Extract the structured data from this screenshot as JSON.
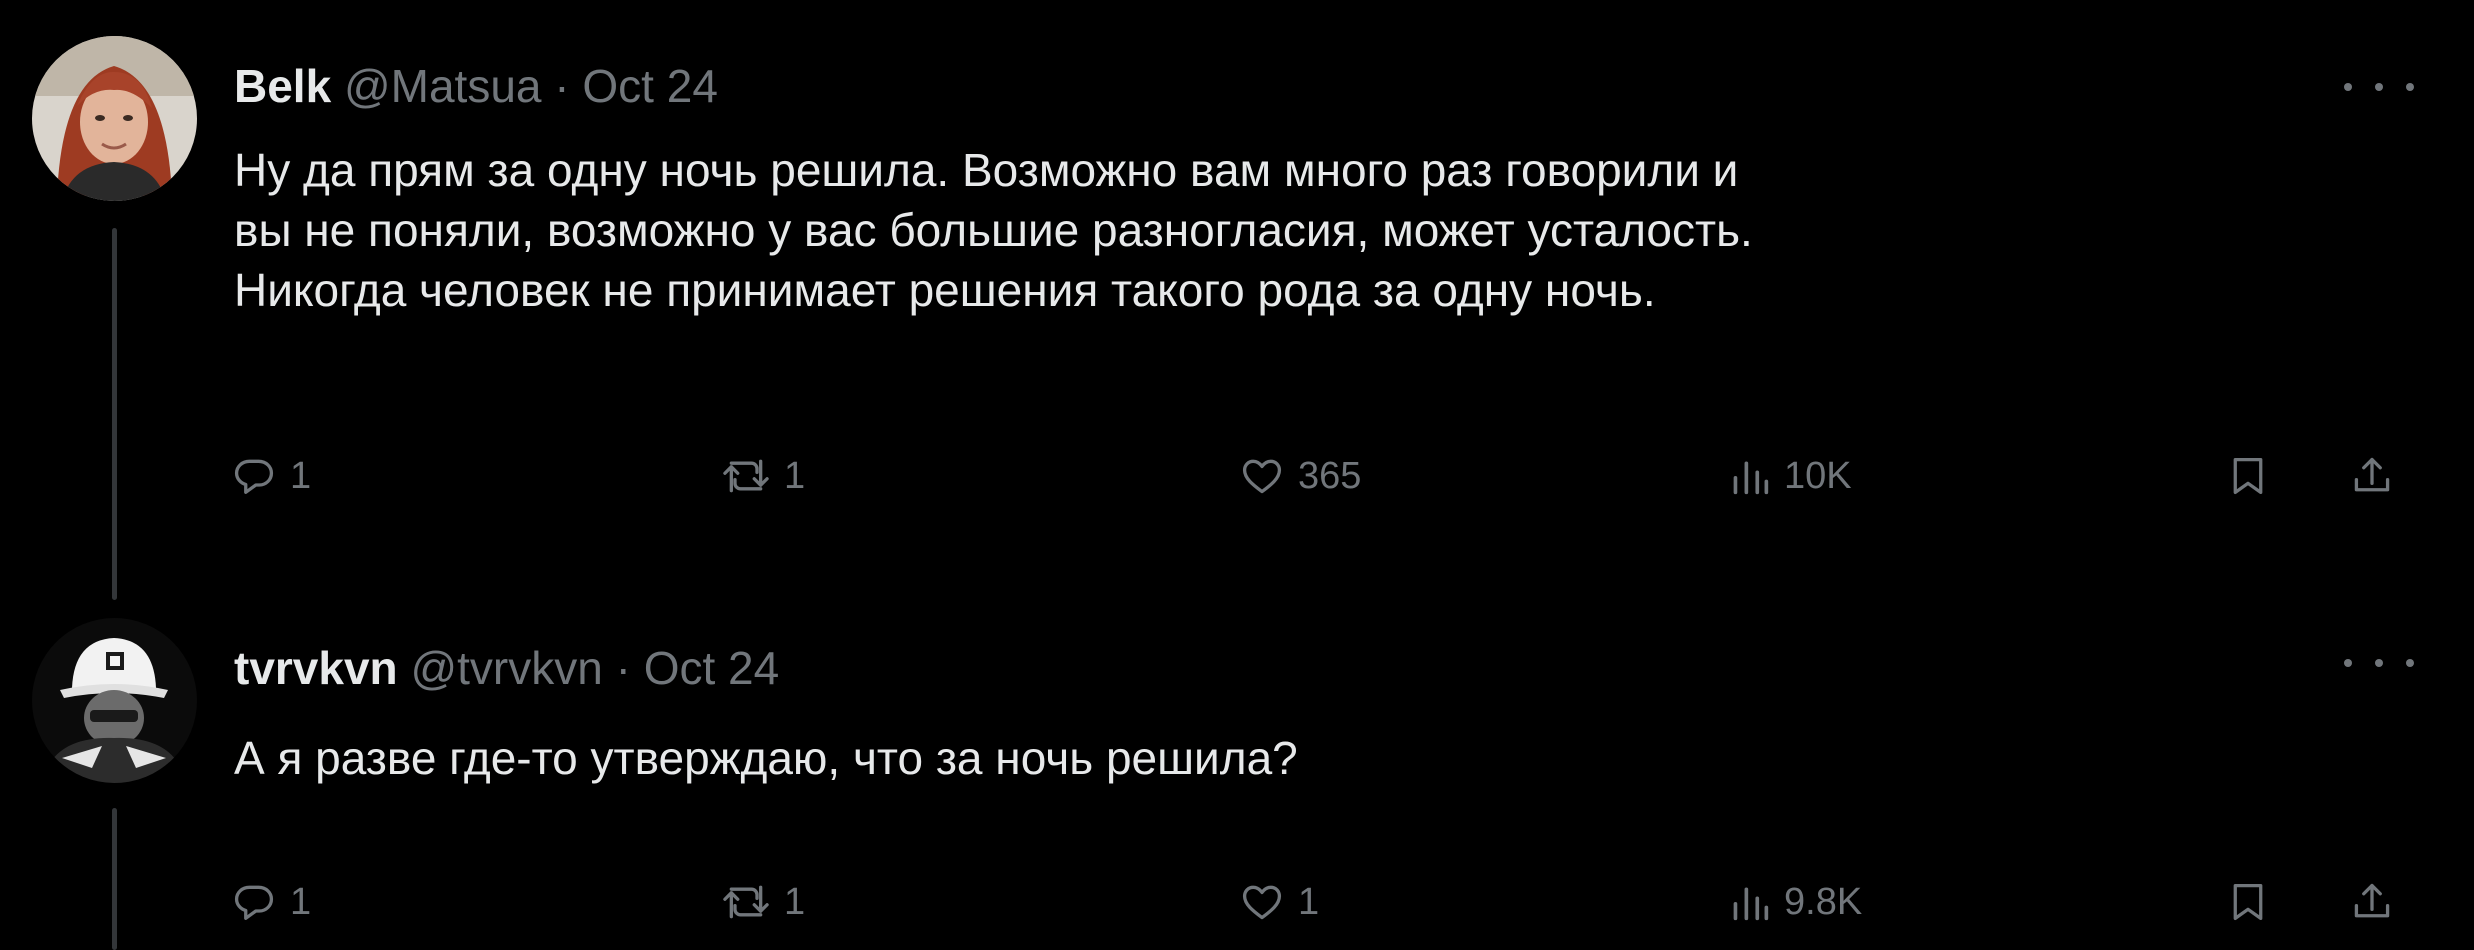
{
  "tweets": [
    {
      "author": {
        "name": "Belk",
        "handle": "@Matsua",
        "separator": "·",
        "date": "Oct 24",
        "avatar_icon": "profile-photo"
      },
      "text_lines": [
        "Ну да прям за одну ночь решила. Возможно вам много раз говорили и",
        "вы не поняли, возможно у вас большие разногласия, может  усталость.",
        "Никогда человек не принимает решения такого рода за одну ночь."
      ],
      "stats": {
        "replies": "1",
        "reposts": "1",
        "likes": "365",
        "views": "10K"
      }
    },
    {
      "author": {
        "name": "tvrvkvn",
        "handle": "@tvrvkvn",
        "separator": "·",
        "date": "Oct 24",
        "avatar_icon": "profile-photo"
      },
      "text_lines": [
        "А я разве где-то утверждаю, что за ночь решила?"
      ],
      "stats": {
        "replies": "1",
        "reposts": "1",
        "likes": "1",
        "views": "9.8K"
      }
    }
  ],
  "icons": {
    "reply": "reply-icon",
    "repost": "repost-icon",
    "like": "heart-icon",
    "views": "bar-chart-icon",
    "bookmark": "bookmark-icon",
    "share": "share-icon",
    "more": "more-horizontal-icon"
  },
  "colors": {
    "background": "#000000",
    "text": "#e7e9ea",
    "muted": "#71767b",
    "thread_line": "#333639"
  }
}
